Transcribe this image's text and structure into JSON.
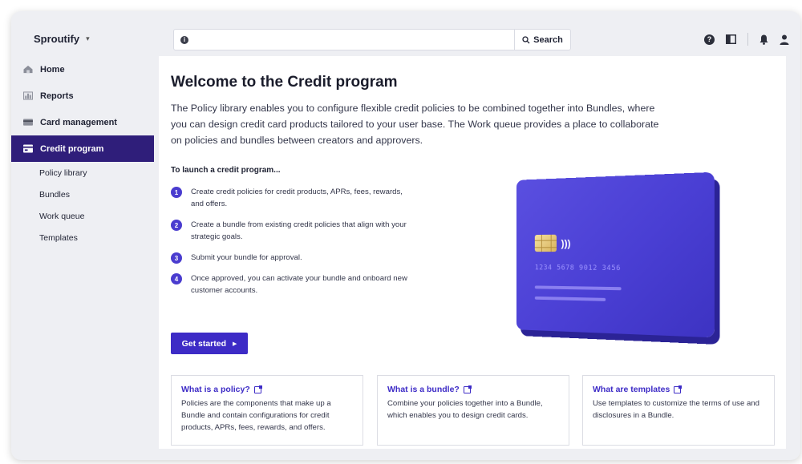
{
  "app": {
    "brand": "Sproutify"
  },
  "search": {
    "value": "",
    "placeholder": "",
    "button_label": "Search"
  },
  "sidebar": {
    "items": [
      {
        "label": "Home",
        "icon": "home-icon"
      },
      {
        "label": "Reports",
        "icon": "reports-icon"
      },
      {
        "label": "Card management",
        "icon": "card-icon"
      },
      {
        "label": "Credit program",
        "icon": "credit-program-icon",
        "active": true
      }
    ],
    "subitems": [
      "Policy library",
      "Bundles",
      "Work queue",
      "Templates"
    ]
  },
  "main": {
    "title": "Welcome to the Credit program",
    "intro": "The Policy library enables you to configure flexible credit policies to be combined together into Bundles, where you can design credit card products tailored to your user base. The Work queue provides a place to collaborate on policies and bundles between creators and approvers.",
    "launch_title": "To launch a credit program...",
    "steps": [
      {
        "num": "1",
        "text": "Create credit policies for credit products, APRs, fees, rewards, and offers."
      },
      {
        "num": "2",
        "text": "Create a bundle from existing credit policies that align with your strategic goals."
      },
      {
        "num": "3",
        "text": "Submit your bundle for approval."
      },
      {
        "num": "4",
        "text": "Once approved, you can activate your bundle and onboard new customer accounts."
      }
    ],
    "cta_label": "Get started",
    "card_number": "1234 5678 9012 3456"
  },
  "info_cards": [
    {
      "title": "What is a policy?",
      "desc": "Policies are the components that make up a Bundle and contain configurations for credit products, APRs, fees, rewards, and offers."
    },
    {
      "title": "What is a bundle?",
      "desc": "Combine your policies together into a Bundle, which enables you to design credit cards."
    },
    {
      "title": "What are templates",
      "desc": "Use templates to customize the terms of use and disclosures in a Bundle."
    }
  ],
  "colors": {
    "accent": "#3d2bc6",
    "sidebar_active": "#2f1e7a",
    "card": "#4a3fd4"
  }
}
